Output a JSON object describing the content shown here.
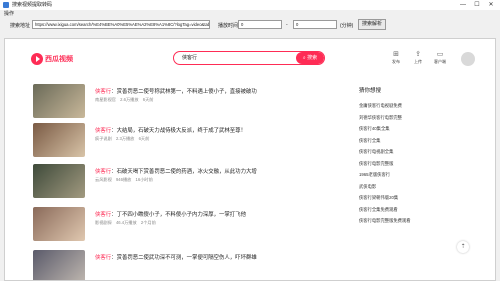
{
  "window": {
    "title": "搜索视频提取转码"
  },
  "menu": {
    "label": "操作"
  },
  "toolbar": {
    "url_label": "搜索地址",
    "url_value": "https://www.ixigua.com/search/%E4%BE%A0%E5%AE%A2%E8%A1%8C/?logTag=video&tab_name=search",
    "time_label": "播放时间",
    "time_from": "0",
    "time_sep": "-",
    "time_to": "0",
    "time_unit": "(分钟)",
    "parse_button": "搜索解析"
  },
  "site": {
    "logo_text": "西瓜视频",
    "search_query": "侠客行",
    "search_button": "搜索",
    "icons": [
      {
        "name": "publish-icon",
        "label": "发布"
      },
      {
        "name": "upload-icon",
        "label": "上传"
      },
      {
        "name": "client-icon",
        "label": "客户端"
      }
    ]
  },
  "results": [
    {
      "title_hl": "侠客行",
      "title_rest": "：赏善罚恶二使号称武林第一，不料遇上傻小子，直接被破功",
      "author": "南星影视官",
      "views": "2.6万播放",
      "date": "6天前",
      "thumb_color": "#6a6a58"
    },
    {
      "title_hl": "侠客行",
      "title_rest": "：大结局，石破天力战侍极大反派，终于成了武林至尊！",
      "author": "疯子说剧",
      "views": "2.3万播放",
      "date": "6天前",
      "thumb_color": "#7a5a44"
    },
    {
      "title_hl": "侠客行",
      "title_rest": "：石破天喝下赏善罚恶二使的药酒，冰火交融，从此功力大增",
      "author": "云风影视",
      "views": "946播放",
      "date": "16小时前",
      "thumb_color": "#3e4a3a"
    },
    {
      "title_hl": "侠客行",
      "title_rest": "：丁不四小瞧傻小子，不料傻小子内力深厚，一掌打飞他",
      "author": "影视剧探",
      "views": "46.4万播放",
      "date": "2个月前",
      "thumb_color": "#8a6a5a"
    },
    {
      "title_hl": "侠客行",
      "title_rest": "：赏善罚恶二使武功深不可测，一掌便可隔空伤人，吓坏群雄",
      "author": "",
      "views": "",
      "date": "",
      "thumb_color": "#5a5a6a"
    }
  ],
  "sidebar": {
    "heading": "猜你想搜",
    "items": [
      "金庸侠客行电视剧免费",
      "刘德华侠客行电影完整",
      "侠客行40集全集",
      "侠客行全集",
      "侠客行电视剧全集",
      "侠客行电影完整版",
      "1965老版侠客行",
      "武侠电影",
      "侠客行梁朝伟版20集",
      "侠客行全集免费观看",
      "侠客行电影完整版免费观看"
    ]
  }
}
